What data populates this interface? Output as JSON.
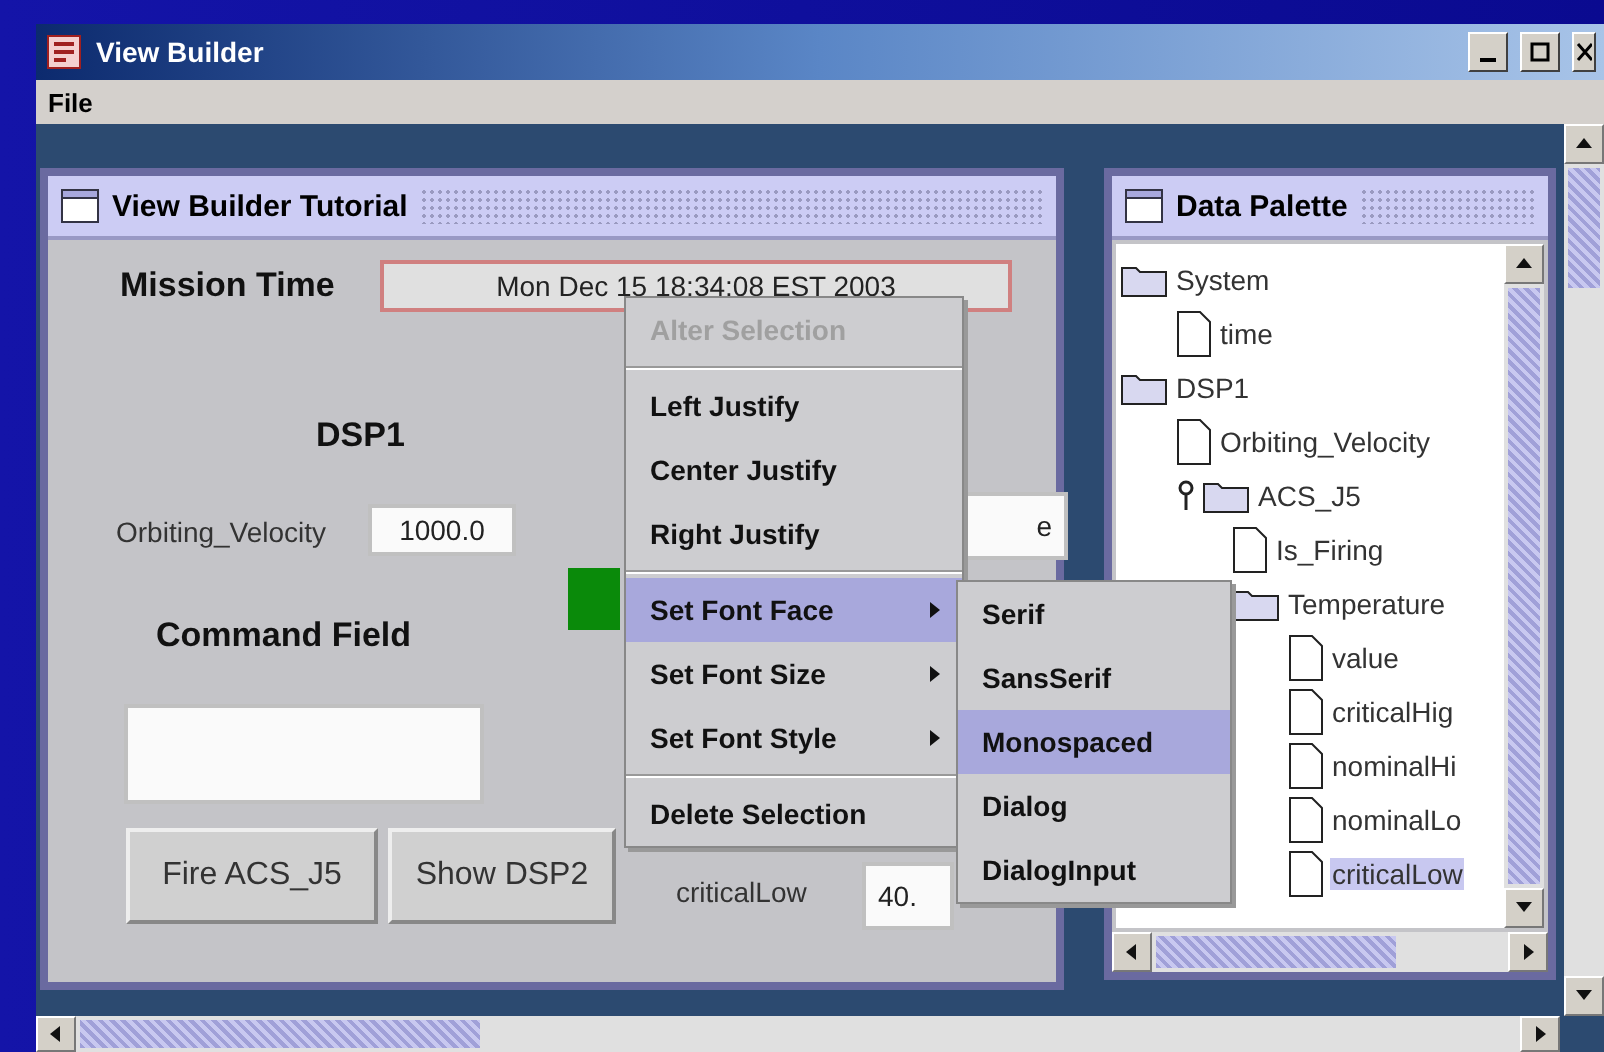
{
  "window": {
    "title": "View Builder"
  },
  "menu": [
    "File"
  ],
  "tutorial": {
    "title": "View Builder Tutorial",
    "mission_label": "Mission Time",
    "mission_time": "Mon Dec 15 18:34:08 EST 2003",
    "dsp_label": "DSP1",
    "velocity_label": "Orbiting_Velocity",
    "velocity_value": "1000.0",
    "covered_value": "e",
    "command_label": "Command Field",
    "buttons": [
      "Fire ACS_J5",
      "Show DSP2"
    ],
    "low_label": "criticalLow",
    "low_value": "40."
  },
  "context_menu": [
    [
      {
        "label": "Alter Selection",
        "disabled": true,
        "selected": false,
        "submenu": false
      }
    ],
    [
      {
        "label": "Left Justify",
        "disabled": false,
        "selected": false,
        "submenu": false
      },
      {
        "label": "Center Justify",
        "disabled": false,
        "selected": false,
        "submenu": false
      },
      {
        "label": "Right Justify",
        "disabled": false,
        "selected": false,
        "submenu": false
      }
    ],
    [
      {
        "label": "Set Font Face",
        "disabled": false,
        "selected": true,
        "submenu": true
      },
      {
        "label": "Set Font Size",
        "disabled": false,
        "selected": false,
        "submenu": true
      },
      {
        "label": "Set Font Style",
        "disabled": false,
        "selected": false,
        "submenu": true
      }
    ],
    [
      {
        "label": "Delete Selection",
        "disabled": false,
        "selected": false,
        "submenu": false
      }
    ]
  ],
  "submenu": [
    {
      "label": "Serif",
      "selected": false
    },
    {
      "label": "SansSerif",
      "selected": false
    },
    {
      "label": "Monospaced",
      "selected": true
    },
    {
      "label": "Dialog",
      "selected": false
    },
    {
      "label": "DialogInput",
      "selected": false
    }
  ],
  "palette": {
    "title": "Data Palette",
    "tree": [
      {
        "label": "System",
        "kind": "folder",
        "selected": false,
        "children": [
          {
            "label": "time",
            "kind": "leaf",
            "selected": false
          }
        ]
      },
      {
        "label": "DSP1",
        "kind": "folder",
        "selected": false,
        "children": [
          {
            "label": "Orbiting_Velocity",
            "kind": "leaf",
            "selected": false
          },
          {
            "label": "ACS_J5",
            "kind": "folder",
            "handle": true,
            "selected": false,
            "children": [
              {
                "label": "Is_Firing",
                "kind": "leaf",
                "selected": false
              },
              {
                "label": "Temperature",
                "kind": "folder",
                "selected": false,
                "children": [
                  {
                    "label": "value",
                    "kind": "leaf",
                    "selected": false
                  },
                  {
                    "label": "criticalHig",
                    "kind": "leaf",
                    "selected": false
                  },
                  {
                    "label": "nominalHi",
                    "kind": "leaf",
                    "selected": false
                  },
                  {
                    "label": "nominalLo",
                    "kind": "leaf",
                    "selected": false
                  },
                  {
                    "label": "criticalLow",
                    "kind": "leaf",
                    "selected": true
                  }
                ]
              }
            ]
          }
        ]
      }
    ]
  }
}
